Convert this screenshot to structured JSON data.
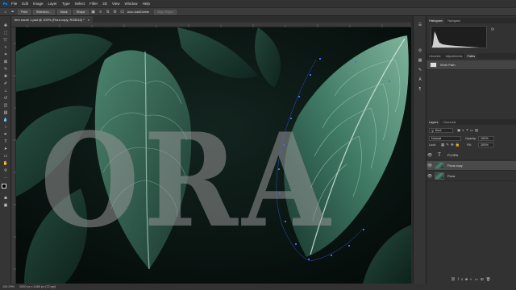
{
  "menubar": {
    "app_logo": "Ps",
    "items": [
      "File",
      "Edit",
      "Image",
      "Layer",
      "Type",
      "Select",
      "Filter",
      "3D",
      "View",
      "Window",
      "Help"
    ]
  },
  "options": {
    "mode": "Path",
    "make_selection": "Selection...",
    "mask": "Mask",
    "shape": "Shape",
    "auto_add_delete": "Auto Add/Delete",
    "align_edges": "Align Edges"
  },
  "document": {
    "tab_title": "fern name 1.psd @ 100% (Flora copy, RGB/16) *"
  },
  "canvas": {
    "overlay_text": "ORA"
  },
  "status": {
    "zoom": "100.29%",
    "doc_info": "1920 px x 1080 px (72 ppi)"
  },
  "histogram": {
    "tabs": [
      "Histogram",
      "Navigator"
    ]
  },
  "paths_panel": {
    "tabs": [
      "Libraries",
      "Adjustments",
      "Paths"
    ],
    "items": [
      "Work Path"
    ]
  },
  "layers_panel": {
    "tabs": [
      "Layers",
      "Channels"
    ],
    "kind_label": "Kind",
    "blend_mode": "Normal",
    "opacity_label": "Opacity:",
    "opacity_value": "100%",
    "lock_label": "Lock:",
    "fill_label": "Fill:",
    "fill_value": "100%",
    "layers": [
      {
        "name": "FLORA",
        "type": "text"
      },
      {
        "name": "Flora copy",
        "type": "image"
      },
      {
        "name": "Flora",
        "type": "image"
      }
    ]
  },
  "colors": {
    "accent": "#31a8ff",
    "selected_layer": "#4a4a4a",
    "path_point": "#3d6bff"
  }
}
